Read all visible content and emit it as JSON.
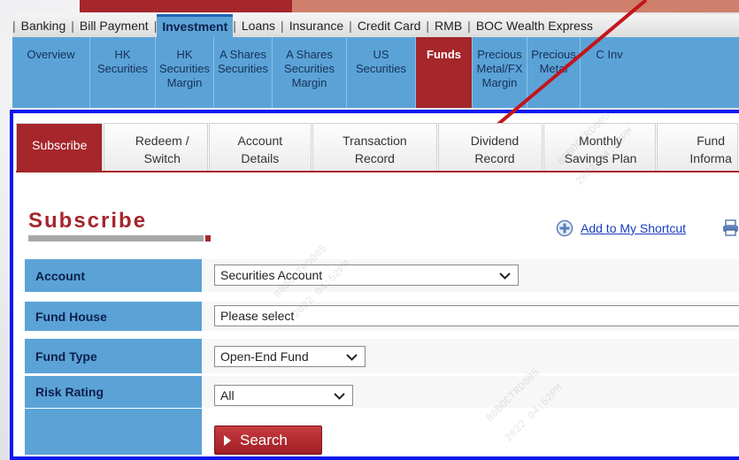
{
  "top_menu": [
    {
      "label": "Banking",
      "active": false
    },
    {
      "label": "Bill Payment",
      "active": false
    },
    {
      "label": "Investment",
      "active": true
    },
    {
      "label": "Loans",
      "active": false
    },
    {
      "label": "Insurance",
      "active": false
    },
    {
      "label": "Credit Card",
      "active": false
    },
    {
      "label": "RMB",
      "active": false
    },
    {
      "label": "BOC Wealth Express",
      "active": false
    }
  ],
  "sub_menu": [
    {
      "label": "Overview",
      "active": false
    },
    {
      "label": "HK Securities",
      "active": false
    },
    {
      "label": "HK Securities Margin",
      "active": false
    },
    {
      "label": "A Shares Securities",
      "active": false
    },
    {
      "label": "A Shares Securities Margin",
      "active": false
    },
    {
      "label": "US Securities",
      "active": false
    },
    {
      "label": "Funds",
      "active": true
    },
    {
      "label": "Precious Metal/FX Margin",
      "active": false
    },
    {
      "label": "Precious Metal",
      "active": false
    },
    {
      "label": "C Inv",
      "active": false
    }
  ],
  "tabs": [
    {
      "label": "Subscribe",
      "active": true
    },
    {
      "label": "Redeem / Switch",
      "active": false
    },
    {
      "label": "Account Details",
      "active": false
    },
    {
      "label": "Transaction Record",
      "active": false
    },
    {
      "label": "Dividend Record",
      "active": false
    },
    {
      "label": "Monthly Savings Plan",
      "active": false
    },
    {
      "label": "Fund Informa",
      "active": false
    }
  ],
  "page_title": "Subscribe",
  "shortcut_label": "Add to My Shortcut",
  "form": {
    "account": {
      "label": "Account",
      "value": "Securities Account"
    },
    "fund_house": {
      "label": "Fund House",
      "value": "Please select"
    },
    "fund_type": {
      "label": "Fund Type",
      "value": "Open-End Fund"
    },
    "risk_rating": {
      "label": "Risk Rating",
      "value": "All"
    }
  },
  "search_label": "Search",
  "watermark": [
    "88BOCTRD005",
    "2022 04:52PM"
  ],
  "colors": {
    "brand_red": "#a5262b",
    "nav_blue": "#5ba3d7",
    "frame_blue": "#0a18f0"
  }
}
